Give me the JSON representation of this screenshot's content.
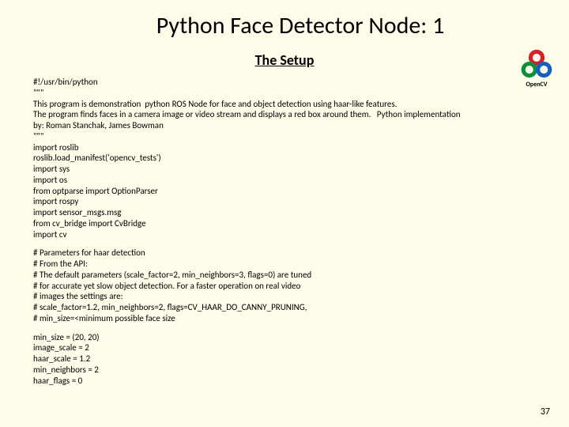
{
  "title": "Python Face Detector Node: 1",
  "subtitle": "The Setup",
  "logo_label": "OpenCV",
  "code_block1": "#!/usr/bin/python\n\"\"\"\nThis program is demonstration  python ROS Node for face and object detection using haar-like features.\nThe program finds faces in a camera image or video stream and displays a red box around them.   Python implementation\nby: Roman Stanchak, James Bowman\n\"\"\"\nimport roslib\nroslib.load_manifest('opencv_tests')\nimport sys\nimport os\nfrom optparse import OptionParser\nimport rospy\nimport sensor_msgs.msg\nfrom cv_bridge import CvBridge\nimport cv",
  "code_block2": "# Parameters for haar detection\n# From the API:\n# The default parameters (scale_factor=2, min_neighbors=3, flags=0) are tuned\n# for accurate yet slow object detection. For a faster operation on real video\n# images the settings are:\n# scale_factor=1.2, min_neighbors=2, flags=CV_HAAR_DO_CANNY_PRUNING,\n# min_size=<minimum possible face size",
  "code_block3": "min_size = (20, 20)\nimage_scale = 2\nhaar_scale = 1.2\nmin_neighbors = 2\nhaar_flags = 0",
  "page_number": "37"
}
